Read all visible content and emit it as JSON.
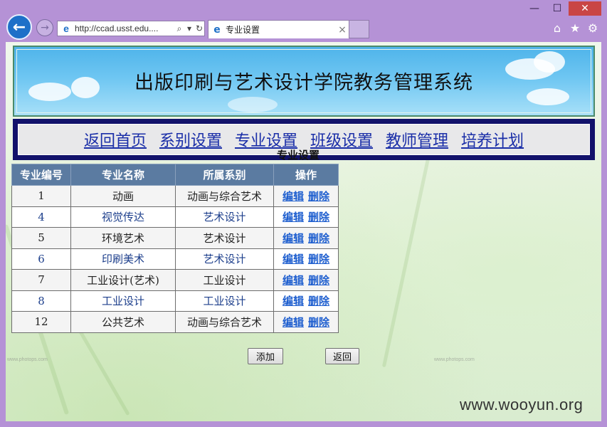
{
  "browser": {
    "address": "http://ccad.usst.edu....",
    "tab_title": "专业设置",
    "window_controls": {
      "minimize": "—",
      "maximize": "☐",
      "close": "✕"
    },
    "icons": [
      "home-icon",
      "star-icon",
      "gear-icon"
    ]
  },
  "banner": {
    "title": "出版印刷与艺术设计学院教务管理系统"
  },
  "nav": {
    "items": [
      "返回首页",
      "系别设置",
      "专业设置",
      "班级设置",
      "教师管理",
      "培养计划"
    ]
  },
  "page": {
    "heading": "专业设置"
  },
  "table": {
    "headers": [
      "专业编号",
      "专业名称",
      "所属系别",
      "操作"
    ],
    "rows": [
      {
        "id": "1",
        "name": "动画",
        "dept": "动画与综合艺术"
      },
      {
        "id": "4",
        "name": "视觉传达",
        "dept": "艺术设计"
      },
      {
        "id": "5",
        "name": "环境艺术",
        "dept": "艺术设计"
      },
      {
        "id": "6",
        "name": "印刷美术",
        "dept": "艺术设计"
      },
      {
        "id": "7",
        "name": "工业设计(艺术)",
        "dept": "工业设计"
      },
      {
        "id": "8",
        "name": "工业设计",
        "dept": "工业设计"
      },
      {
        "id": "12",
        "name": "公共艺术",
        "dept": "动画与综合艺术"
      }
    ],
    "edit_label": "编辑",
    "delete_label": "删除"
  },
  "buttons": {
    "add": "添加",
    "back": "返回"
  },
  "watermark": "www.wooyun.org",
  "faint_text": "www.photops.com"
}
